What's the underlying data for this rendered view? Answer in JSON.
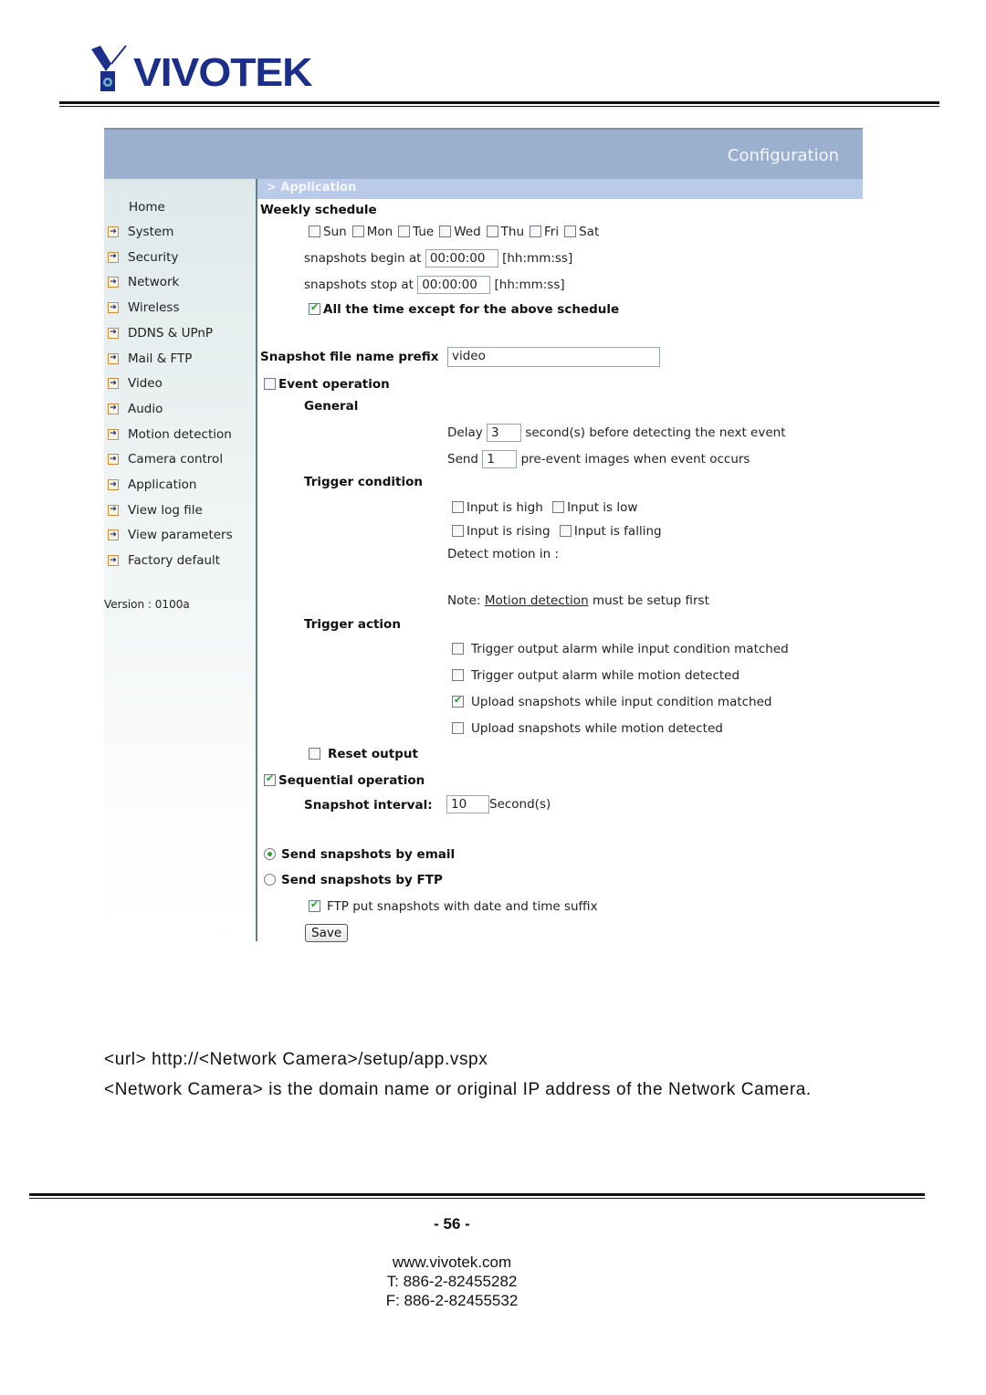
{
  "logo": {
    "brand": "VIVOTEK",
    "brand_color": "#1b2f8a"
  },
  "config": {
    "title": "Configuration",
    "breadcrumb": "> Application",
    "header_color": "#9bb0cf",
    "breadcrumb_color": "#b9cbe8"
  },
  "sidebar": {
    "home": "Home",
    "items": [
      {
        "label": "System"
      },
      {
        "label": "Security"
      },
      {
        "label": "Network"
      },
      {
        "label": "Wireless"
      },
      {
        "label": "DDNS & UPnP"
      },
      {
        "label": "Mail & FTP"
      },
      {
        "label": "Video"
      },
      {
        "label": "Audio"
      },
      {
        "label": "Motion detection"
      },
      {
        "label": "Camera control"
      },
      {
        "label": "Application"
      },
      {
        "label": "View log file"
      },
      {
        "label": "View parameters"
      },
      {
        "label": "Factory default"
      }
    ],
    "version": "Version : 0100a"
  },
  "form": {
    "weekly_schedule": {
      "label": "Weekly schedule",
      "days": [
        {
          "label": "Sun",
          "checked": false
        },
        {
          "label": "Mon",
          "checked": false
        },
        {
          "label": "Tue",
          "checked": false
        },
        {
          "label": "Wed",
          "checked": false
        },
        {
          "label": "Thu",
          "checked": false
        },
        {
          "label": "Fri",
          "checked": false
        },
        {
          "label": "Sat",
          "checked": false
        }
      ],
      "begin_label": "snapshots begin at",
      "begin_value": "00:00:00",
      "stop_label": "snapshots stop at",
      "stop_value": "00:00:00",
      "time_format": "[hh:mm:ss]",
      "all_time_label": "All the time except for the above schedule",
      "all_time_checked": true
    },
    "prefix": {
      "label": "Snapshot file name prefix",
      "value": "video"
    },
    "event_operation": {
      "label": "Event operation",
      "checked": false
    },
    "general": {
      "label": "General",
      "delay_label": "Delay",
      "delay_value": "3",
      "delay_suffix": "second(s) before detecting the next event",
      "send_label": "Send",
      "send_value": "1",
      "send_suffix": "pre-event images when event occurs"
    },
    "trigger_condition": {
      "label": "Trigger condition",
      "input_high": "Input is high",
      "input_low": "Input is low",
      "input_rising": "Input is rising",
      "input_falling": "Input is falling",
      "detect_motion": "Detect motion in :",
      "note_prefix": "Note:",
      "note_link": "Motion detection",
      "note_suffix": "must be setup first"
    },
    "trigger_action": {
      "label": "Trigger action",
      "items": [
        {
          "label": "Trigger output alarm while input condition matched",
          "checked": false
        },
        {
          "label": "Trigger output alarm while motion detected",
          "checked": false
        },
        {
          "label": "Upload snapshots while input condition matched",
          "checked": true
        },
        {
          "label": "Upload snapshots while motion detected",
          "checked": false
        }
      ]
    },
    "reset_output": {
      "label": "Reset output",
      "checked": false
    },
    "sequential": {
      "label": "Sequential operation",
      "checked": true
    },
    "interval": {
      "label": "Snapshot interval:",
      "value": "10",
      "unit": "Second(s)"
    },
    "send_email": {
      "label": "Send snapshots by email",
      "selected": true
    },
    "send_ftp": {
      "label": "Send snapshots by FTP",
      "selected": false
    },
    "ftp_suffix": {
      "label": "FTP put snapshots with date and time suffix",
      "checked": true
    },
    "save_label": "Save"
  },
  "doc": {
    "url_line": "<url> http://<Network Camera>/setup/app.vspx",
    "desc_line": "<Network Camera> is the domain name or original IP address of the Network Camera."
  },
  "footer": {
    "page": "- 56 -",
    "website": "www.vivotek.com",
    "tel": "T: 886-2-82455282",
    "fax": "F: 886-2-82455532"
  }
}
